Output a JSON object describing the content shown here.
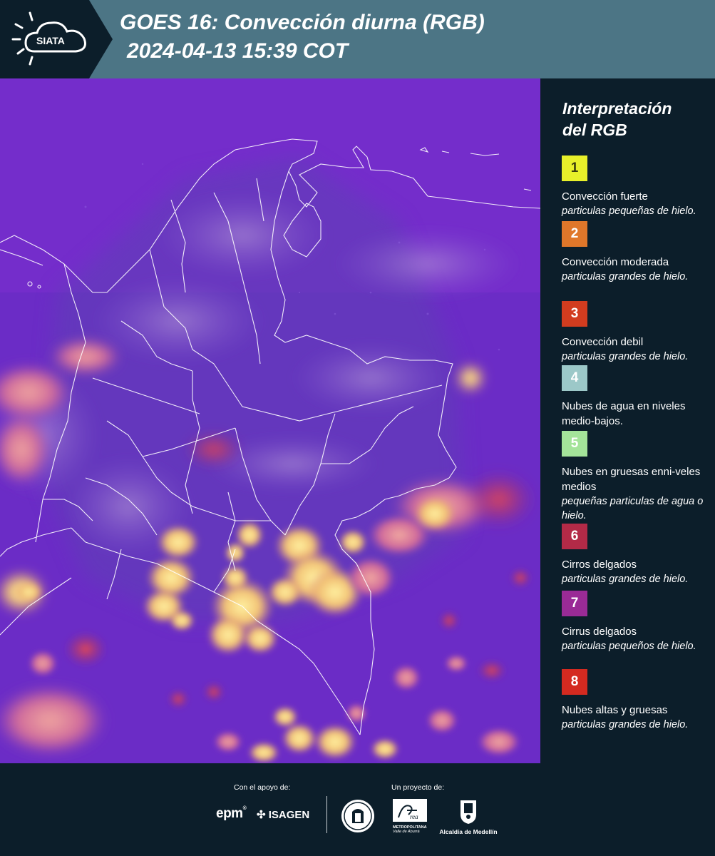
{
  "header": {
    "logo_text": "SIATA",
    "title_line1": "GOES 16: Convección diurna (RGB)",
    "title_line2": "2024-04-13 15:39 COT"
  },
  "legend": {
    "title_line1": "Interpretación",
    "title_line2": "del RGB",
    "items": [
      {
        "number": "1",
        "color": "#e8f02a",
        "text_color": "#3a3a10",
        "title": "Convección fuerte",
        "subtitle": "particulas pequeñas de hielo."
      },
      {
        "number": "2",
        "color": "#e0772a",
        "text_color": "#ffffff",
        "title": "Convección moderada",
        "subtitle": "particulas grandes de hielo."
      },
      {
        "number": "3",
        "color": "#d23c1f",
        "text_color": "#ffffff",
        "title": "Convección debil",
        "subtitle": "particulas grandes de hielo."
      },
      {
        "number": "4",
        "color": "#9cc8c8",
        "text_color": "#ffffff",
        "title": "Nubes de agua en niveles medio-bajos.",
        "subtitle": ""
      },
      {
        "number": "5",
        "color": "#a4e49a",
        "text_color": "#ffffff",
        "title": "Nubes en gruesas enni-veles medios",
        "subtitle": "pequeñas particulas de agua o hielo."
      },
      {
        "number": "6",
        "color": "#b32a47",
        "text_color": "#ffffff",
        "title": "Cirros delgados",
        "subtitle": "particulas grandes de hielo."
      },
      {
        "number": "7",
        "color": "#9a2b96",
        "text_color": "#ffffff",
        "title": "Cirrus delgados",
        "subtitle": "particulas pequeños de hielo."
      },
      {
        "number": "8",
        "color": "#d42a20",
        "text_color": "#ffffff",
        "title": "Nubes altas y gruesas",
        "subtitle": "particulas grandes de hielo."
      }
    ]
  },
  "footer": {
    "support_label": "Con el apoyo de:",
    "project_label": "Un proyecto de:",
    "sponsor_epm": "epm",
    "sponsor_isagen": "ISAGEN",
    "sponsor_area_line1": "METROPOLITANA",
    "sponsor_area_line2": "Valle de Aburrá",
    "sponsor_alcaldia": "Alcaldía de Medellín"
  },
  "colors": {
    "header_bg": "#4c7585",
    "panel_bg": "#0c1e2a",
    "map_base": "#6f2fc4"
  }
}
